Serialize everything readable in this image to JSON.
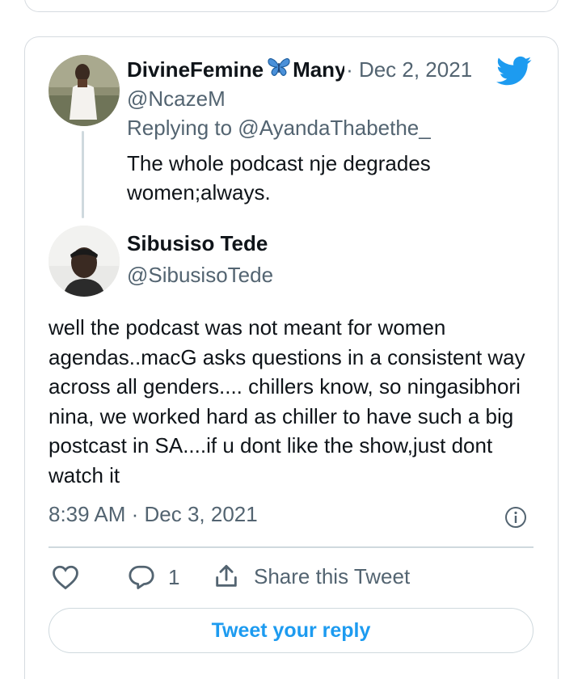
{
  "parent_tweet": {
    "display_name": "DivineFemine",
    "display_name_suffix": "Many",
    "date": "· Dec 2, 2021",
    "handle": "@NcazeM",
    "replying_to": "Replying to @AyandaThabethe_",
    "text": "The whole podcast nje degrades women;always."
  },
  "main_tweet": {
    "display_name": "Sibusiso Tede",
    "handle": "@SibusisoTede",
    "text": "well the podcast was not meant for women agendas..macG asks questions in a consistent way across all genders.... chillers know, so ningasibhori nina, we worked hard as chiller to have such a big postcast in SA....if u dont like the show,just dont watch it",
    "timestamp": "8:39 AM · Dec 3, 2021"
  },
  "actions": {
    "reply_count": "1",
    "share_label": "Share this Tweet"
  },
  "reply_button_label": "Tweet your reply",
  "icons": [
    "butterfly-icon",
    "twitter-bird-icon",
    "info-icon",
    "heart-icon",
    "reply-icon",
    "share-icon"
  ],
  "colors": {
    "brand_blue": "#1d9bf0",
    "secondary_text": "#536471",
    "border": "#cfd9de",
    "butterfly": "#2f7fc9"
  }
}
